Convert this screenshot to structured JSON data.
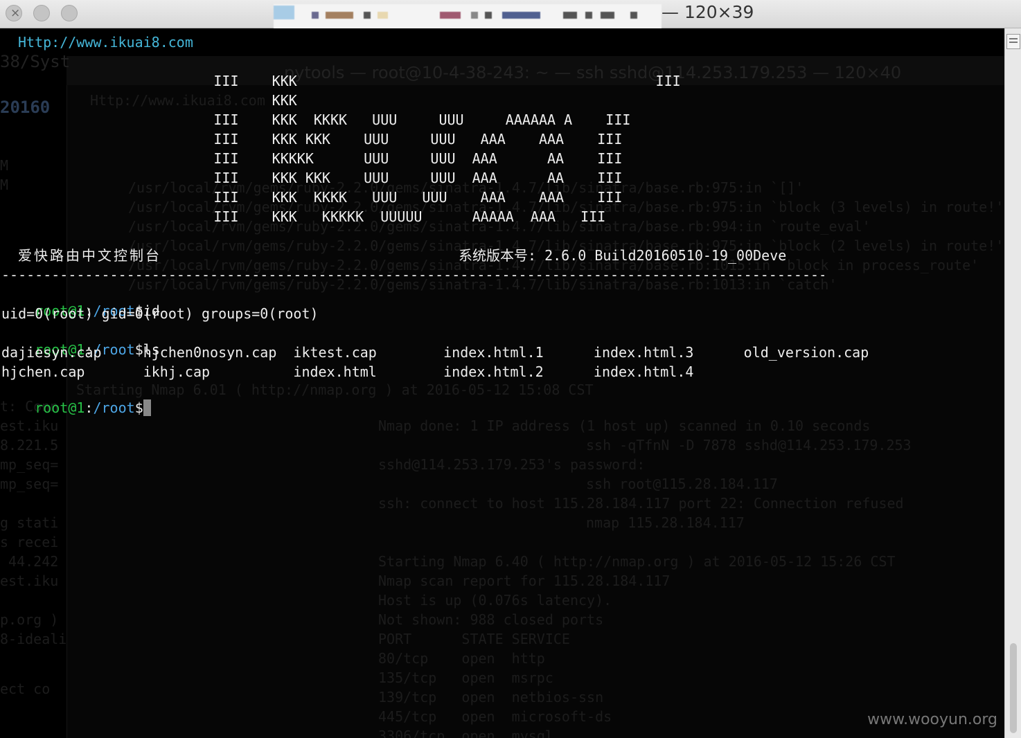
{
  "window": {
    "title": "— 120×39"
  },
  "terminal": {
    "url_line": "Http://www.ikuai8.com",
    "banner": [
      "         III    KKK                                           III",
      "                KKK",
      "         III    KKK  KKKK   UUU     UUU     AAAAAA A    III",
      "         III    KKK KKK    UUU     UUU   AAA    AAA    III",
      "         III    KKKKK      UUU     UUU  AAA      AA    III",
      "         III    KKK KKK    UUU     UUU  AAA      AA    III",
      "         III    KKK  KKKK   UUU   UUU    AAA    AAA    III",
      "         III    KKK   KKKKK  UUUUU      AAAAA  AAA   III"
    ],
    "console_name": "爱快路由中文控制台",
    "version_text": "系统版本号: 2.6.0 Build20160510-19_00Deve",
    "separator": "--------------------------------------------------------------------------------------------------------------------",
    "prompt_user": "root@1",
    "prompt_colon": ":",
    "prompt_path": "/root",
    "prompt_dollar": "$",
    "cmd1": "id",
    "id_output": "uid=0(root) gid=0(root) groups=0(root)",
    "cmd2": "ls",
    "ls_row1": "dajiesyn.cap     hjchen0nosyn.cap  iktest.cap        index.html.1      index.html.3      old_version.cap",
    "ls_row2": "hjchen.cap       ikhj.cap          index.html        index.html.2      index.html.4",
    "cmd3": ""
  },
  "background_window": {
    "title": "pytools — root@10-4-38-243: ~ — ssh sshd@114.253.179.253 — 120×40",
    "left_fragments": [
      "38/Syst",
      "20160",
      "M",
      "M",
      "t: Conn",
      "est.iku",
      "8.221.5",
      "mp_seq=",
      "mp_seq=",
      "g stati",
      "s recei",
      " 44.242",
      "est.iku",
      "p.org )",
      "8-ideali",
      "ect co"
    ],
    "lines": [
      "Http://www.ikuai8.com",
      "/usr/local/rvm/gems/ruby-2.2.0/gems/sinatra-1.4.7/lib/sinatra/base.rb:975:in `[]'",
      "/usr/local/rvm/gems/ruby-2.2.0/gems/sinatra-1.4.7/lib/sinatra/base.rb:975:in `block (3 levels) in route!'",
      "/usr/local/rvm/gems/ruby-2.2.0/gems/sinatra-1.4.7/lib/sinatra/base.rb:994:in `route_eval'",
      "/usr/local/rvm/gems/ruby-2.2.0/gems/sinatra-1.4.7/lib/sinatra/base.rb:975:in `block (2 levels) in route!'",
      "/usr/local/rvm/gems/ruby-2.2.0/gems/sinatra-1.4.7/lib/sinatra/base.rb:1015:in `block in process_route'",
      "/usr/local/rvm/gems/ruby-2.2.0/gems/sinatra-1.4.7/lib/sinatra/base.rb:1013:in `catch'",
      "Starting Nmap 6.01 ( http://nmap.org ) at 2016-05-12 15:08 CST",
      "Nmap done: 1 IP address (1 host up) scanned in 0.10 seconds",
      "ssh -qTfnN -D 7878 sshd@114.253.179.253",
      "sshd@114.253.179.253's password:",
      "ssh root@115.28.184.117",
      "ssh: connect to host 115.28.184.117 port 22: Connection refused",
      "nmap 115.28.184.117",
      "Starting Nmap 6.40 ( http://nmap.org ) at 2016-05-12 15:26 CST",
      "Nmap scan report for 115.28.184.117",
      "Host is up (0.076s latency).",
      "Not shown: 988 closed ports",
      "PORT      STATE SERVICE",
      "80/tcp    open  http",
      "135/tcp   open  msrpc",
      "139/tcp   open  netbios-ssn",
      "445/tcp   open  microsoft-ds",
      "3306/tcp  open  mysql"
    ]
  },
  "watermark": "www.wooyun.org",
  "colors": {
    "prompt_green": "#27c247",
    "path_blue": "#4da6e6",
    "url_cyan": "#45b6d8",
    "text": "#eeeeee",
    "background": "#000000"
  },
  "icons": [
    "close-icon",
    "minimize-icon",
    "zoom-icon",
    "folder-icon",
    "scroll-menu-icon"
  ]
}
